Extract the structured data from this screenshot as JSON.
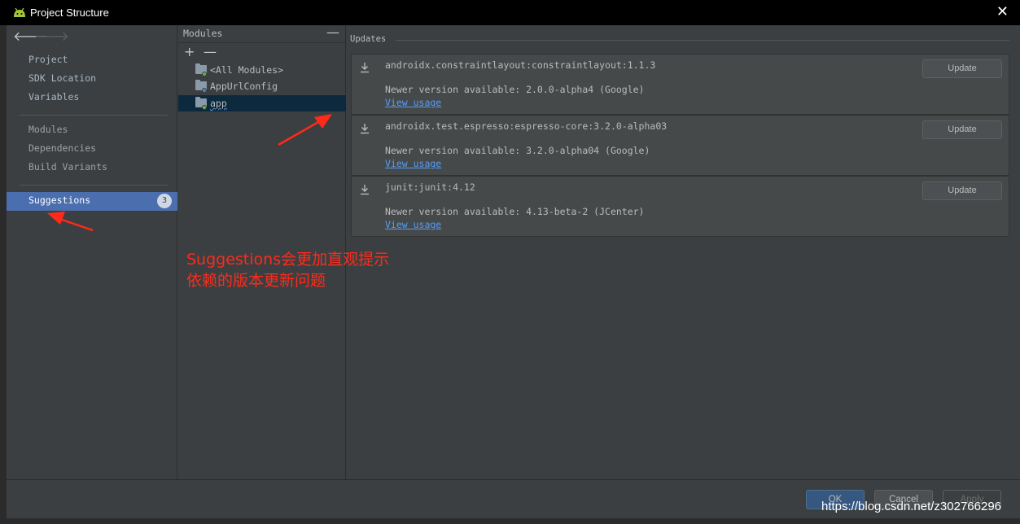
{
  "window": {
    "title": "Project Structure",
    "close_glyph": "✕"
  },
  "nav": {
    "back_glyph": "🡐",
    "forward_glyph": "🡒",
    "group1": [
      "Project",
      "SDK Location",
      "Variables"
    ],
    "group2": [
      "Modules",
      "Dependencies",
      "Build Variants"
    ],
    "selected": {
      "label": "Suggestions",
      "badge": "3"
    }
  },
  "modules": {
    "header": "Modules",
    "collapse_glyph": "—",
    "add_glyph": "+",
    "remove_glyph": "—",
    "items": [
      {
        "label": "<All Modules>"
      },
      {
        "label": "AppUrlConfig"
      },
      {
        "label": "app",
        "selected": true
      }
    ]
  },
  "updates": {
    "title": "Updates",
    "cards": [
      {
        "package": "androidx.constraintlayout:constraintlayout:1.1.3",
        "available": "Newer version available: 2.0.0-alpha4 (Google)",
        "link": "View usage",
        "button": "Update"
      },
      {
        "package": "androidx.test.espresso:espresso-core:3.2.0-alpha03",
        "available": "Newer version available: 3.2.0-alpha04 (Google)",
        "link": "View usage",
        "button": "Update"
      },
      {
        "package": "junit:junit:4.12",
        "available": "Newer version available: 4.13-beta-2 (JCenter)",
        "link": "View usage",
        "button": "Update"
      }
    ]
  },
  "footer": {
    "ok": "OK",
    "cancel": "Cancel",
    "apply": "Apply"
  },
  "annotation": {
    "line1": "Suggestions会更加直观提示",
    "line2": "依赖的版本更新问题"
  },
  "watermark": "https://blog.csdn.net/z302766296",
  "colors": {
    "accent_selected": "#4b6eaf",
    "link": "#589df6",
    "annotation": "#ff2a1a",
    "android_green": "#a4c639"
  }
}
